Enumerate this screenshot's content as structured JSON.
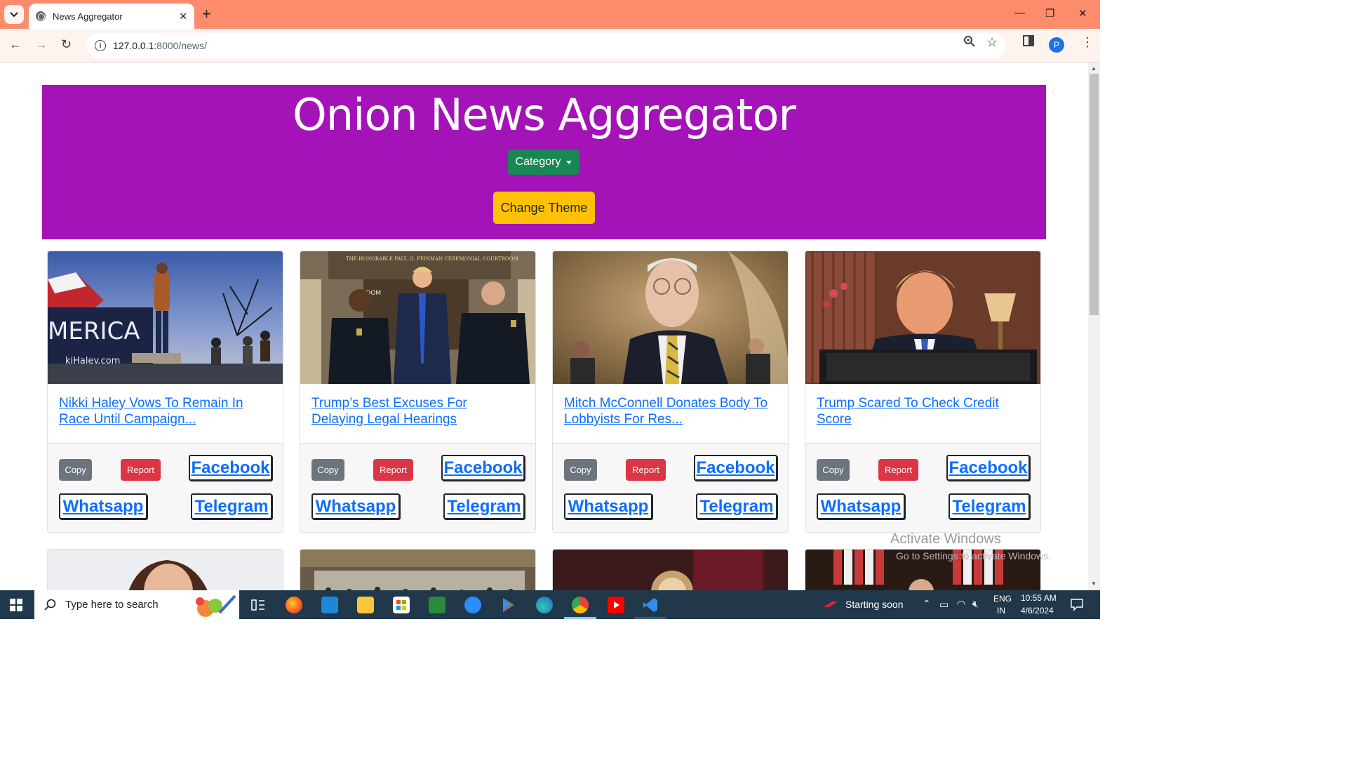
{
  "browser": {
    "tab_title": "News Aggregator",
    "url_host": "127.0.0.1",
    "url_rest": ":8000/news/",
    "profile_initial": "P"
  },
  "page": {
    "title": "Onion News Aggregator",
    "category_label": "Category",
    "theme_label": "Change Theme",
    "cards": [
      {
        "title": "Nikki Haley Vows To Remain In Race Until Campaign...",
        "copy": "Copy",
        "report": "Report",
        "facebook": "Facebook",
        "whatsapp": "Whatsapp",
        "telegram": "Telegram"
      },
      {
        "title": "Trump’s Best Excuses For Delaying Legal Hearings",
        "copy": "Copy",
        "report": "Report",
        "facebook": "Facebook",
        "whatsapp": "Whatsapp",
        "telegram": "Telegram"
      },
      {
        "title": "Mitch McConnell Donates Body To Lobbyists For Res...",
        "copy": "Copy",
        "report": "Report",
        "facebook": "Facebook",
        "whatsapp": "Whatsapp",
        "telegram": "Telegram"
      },
      {
        "title": "Trump Scared To Check Credit Score",
        "copy": "Copy",
        "report": "Report",
        "facebook": "Facebook",
        "whatsapp": "Whatsapp",
        "telegram": "Telegram"
      }
    ],
    "watermark": "Activate Windows",
    "watermark_sub": "Go to Settings to activate Windows."
  },
  "taskbar": {
    "search_placeholder": "Type here to search",
    "notification": "Starting soon",
    "lang": "ENG",
    "region": "IN",
    "time": "10:55 AM",
    "date": "4/6/2024"
  },
  "colors": {
    "hero": "#a313b7",
    "category": "#198754",
    "theme": "#ffc107",
    "copy": "#6c757d",
    "report": "#dc3545",
    "link": "#0d6efd"
  }
}
